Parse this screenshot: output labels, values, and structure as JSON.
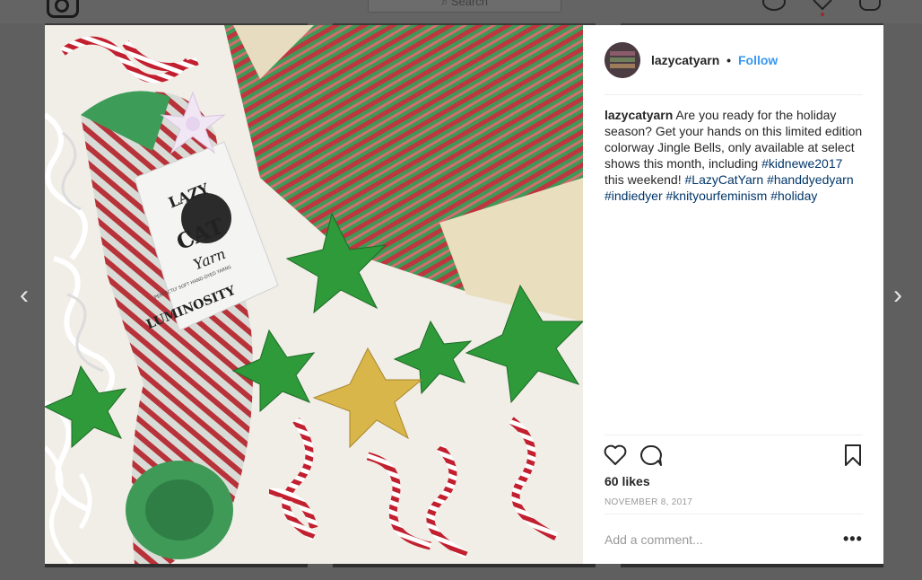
{
  "topbar": {
    "search_placeholder": "Search"
  },
  "post": {
    "username": "lazycatyarn",
    "follow_label": "Follow",
    "separator": "•",
    "caption": {
      "username": "lazycatyarn",
      "text": " Are you ready for the holiday season? Get your hands on this limited edition colorway Jingle Bells, only available at select shows this month, including ",
      "tag_kidnewe": "#kidnewe2017",
      "mid_text": " this weekend! ",
      "tag_lazycat": "#LazyCatYarn",
      "tag_handdyed": "#handdyedyarn",
      "tag_indiedyer": "#indiedyer",
      "tag_knit": "#knityourfeminism",
      "tag_holiday": "#holiday"
    },
    "likes": "60 likes",
    "date": "NOVEMBER 8, 2017",
    "comment_placeholder": "Add a comment...",
    "more_label": "•••",
    "image_label": {
      "brand_top": "LAZY",
      "brand_mid": "CAT",
      "brand_script": "Yarn",
      "tagline": "PERFECTLY SOFT HAND-DYED YARNS",
      "product": "LUMINOSITY"
    }
  },
  "nav": {
    "prev_label": "‹",
    "next_label": "›"
  },
  "colors": {
    "accent": "#3897f0",
    "hashtag": "#003569",
    "text": "#262626",
    "muted": "#999999"
  }
}
